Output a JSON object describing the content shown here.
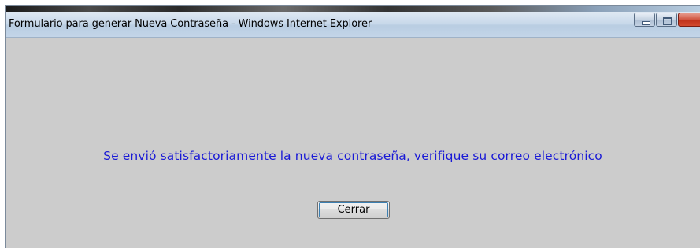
{
  "window": {
    "title": "Formulario para generar Nueva Contraseña - Windows Internet Explorer",
    "controls": {
      "minimize_icon": "minimize-icon",
      "maximize_icon": "maximize-icon",
      "close_icon": "close-icon"
    }
  },
  "main": {
    "message": "Se envió satisfactoriamente la nueva contraseña, verifique su correo electrónico",
    "close_button_label": "Cerrar"
  },
  "colors": {
    "message_text": "#1a1ad6",
    "content_background": "#cccccc",
    "titlebar": "#c9d9ea",
    "close_control": "#c8381f"
  }
}
